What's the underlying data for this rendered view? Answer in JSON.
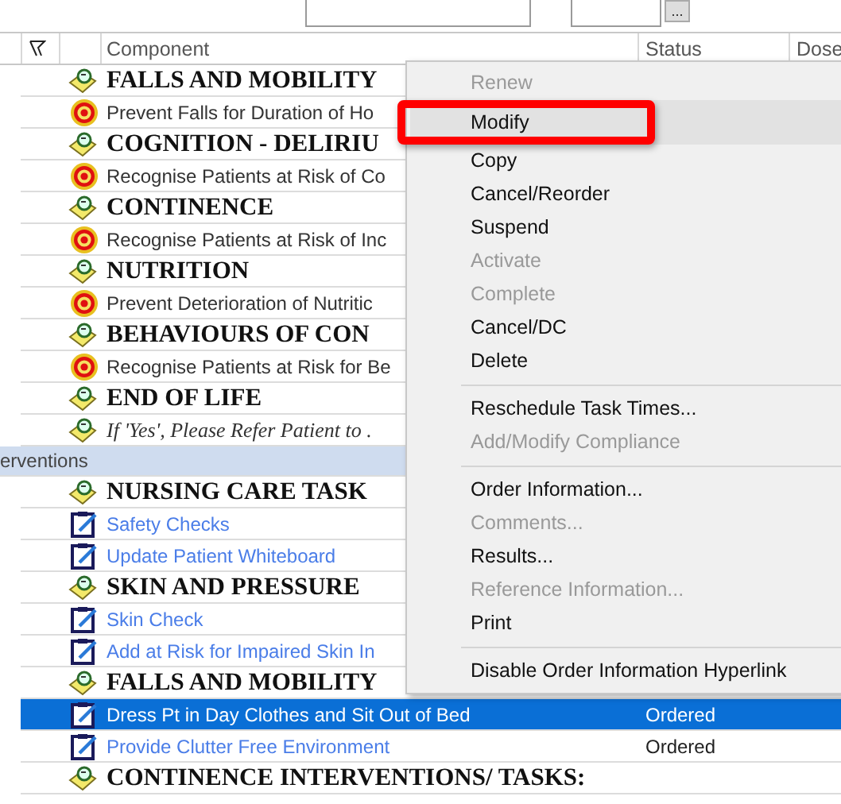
{
  "toolbar": {
    "button": "..."
  },
  "columns": [
    {
      "kind": "flag"
    },
    {
      "kind": "icon"
    },
    {
      "kind": "component",
      "label": "Component"
    },
    {
      "kind": "status",
      "label": "Status"
    },
    {
      "kind": "dose",
      "label": "Dose"
    }
  ],
  "rows": [
    {
      "kind": "group",
      "text": "FALLS AND MOBILITY"
    },
    {
      "kind": "goal",
      "text": "Prevent Falls for Duration of Ho"
    },
    {
      "kind": "group",
      "text": "COGNITION - DELIRIU"
    },
    {
      "kind": "goal",
      "text": "Recognise Patients at Risk of Co"
    },
    {
      "kind": "group",
      "text": "CONTINENCE"
    },
    {
      "kind": "goal",
      "text": "Recognise Patients at Risk of Inc"
    },
    {
      "kind": "group",
      "text": "NUTRITION"
    },
    {
      "kind": "goal",
      "text": "Prevent Deterioration of Nutritic"
    },
    {
      "kind": "group",
      "text": "BEHAVIOURS OF CON"
    },
    {
      "kind": "goal",
      "text": "Recognise Patients at Risk for Be"
    },
    {
      "kind": "group",
      "text": "END OF LIFE"
    },
    {
      "kind": "note",
      "text": "If 'Yes', Please Refer Patient to ."
    },
    {
      "kind": "section",
      "text": "erventions"
    },
    {
      "kind": "group",
      "text": "NURSING CARE TASK"
    },
    {
      "kind": "task",
      "text": "Safety Checks",
      "selected": false
    },
    {
      "kind": "task",
      "text": "Update Patient Whiteboard",
      "selected": false
    },
    {
      "kind": "group",
      "text": "SKIN AND PRESSURE"
    },
    {
      "kind": "task",
      "text": "Skin Check",
      "selected": false
    },
    {
      "kind": "task",
      "text": "Add at Risk for Impaired Skin In",
      "selected": false
    },
    {
      "kind": "group",
      "text": "FALLS AND MOBILITY"
    },
    {
      "kind": "task",
      "text": "Dress Pt in Day Clothes and Sit Out of Bed",
      "status": "Ordered",
      "selected": true
    },
    {
      "kind": "task",
      "text": "Provide Clutter Free Environment",
      "status": "Ordered",
      "selected": false
    },
    {
      "kind": "group",
      "text": "CONTINENCE INTERVENTIONS/ TASKS:"
    }
  ],
  "menu": [
    {
      "kind": "item",
      "label": "Renew",
      "disabled": true,
      "selected": false
    },
    {
      "kind": "item",
      "label": "Modify",
      "disabled": false,
      "selected": true
    },
    {
      "kind": "item",
      "label": "Copy",
      "disabled": false,
      "selected": false
    },
    {
      "kind": "item",
      "label": "Cancel/Reorder",
      "disabled": false,
      "selected": false
    },
    {
      "kind": "item",
      "label": "Suspend",
      "disabled": false,
      "selected": false
    },
    {
      "kind": "item",
      "label": "Activate",
      "disabled": true,
      "selected": false
    },
    {
      "kind": "item",
      "label": "Complete",
      "disabled": true,
      "selected": false
    },
    {
      "kind": "item",
      "label": "Cancel/DC",
      "disabled": false,
      "selected": false
    },
    {
      "kind": "item",
      "label": "Delete",
      "disabled": false,
      "selected": false
    },
    {
      "kind": "separator"
    },
    {
      "kind": "item",
      "label": "Reschedule Task Times...",
      "disabled": false,
      "selected": false
    },
    {
      "kind": "item",
      "label": "Add/Modify Compliance",
      "disabled": true,
      "selected": false
    },
    {
      "kind": "separator"
    },
    {
      "kind": "item",
      "label": "Order Information...",
      "disabled": false,
      "selected": false
    },
    {
      "kind": "item",
      "label": "Comments...",
      "disabled": true,
      "selected": false
    },
    {
      "kind": "item",
      "label": "Results...",
      "disabled": false,
      "selected": false
    },
    {
      "kind": "item",
      "label": "Reference Information...",
      "disabled": true,
      "selected": false
    },
    {
      "kind": "item",
      "label": "Print",
      "disabled": false,
      "selected": false
    },
    {
      "kind": "separator"
    },
    {
      "kind": "item",
      "label": "Disable Order Information Hyperlink",
      "disabled": false,
      "selected": false
    }
  ]
}
